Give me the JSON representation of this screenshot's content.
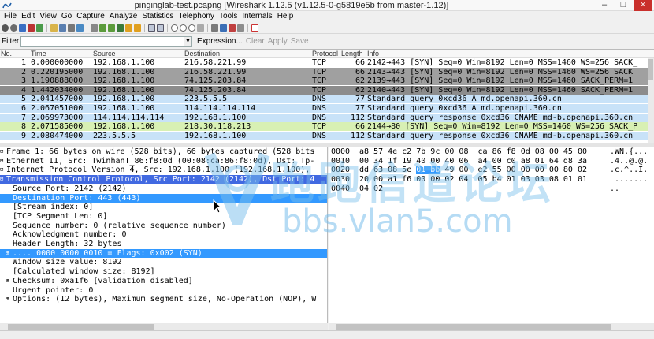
{
  "window": {
    "title": "pinginglab-test.pcapng   [Wireshark 1.12.5  (v1.12.5-0-g5819e5b from master-1.12)]",
    "min": "–",
    "max": "□",
    "close": "×"
  },
  "menu": [
    "File",
    "Edit",
    "View",
    "Go",
    "Capture",
    "Analyze",
    "Statistics",
    "Telephony",
    "Tools",
    "Internals",
    "Help"
  ],
  "filter": {
    "label": "Filter:",
    "value": "",
    "expression": "Expression...",
    "clear": "Clear",
    "apply": "Apply",
    "save": "Save"
  },
  "packet_list": {
    "columns": {
      "no": "No.",
      "time": "Time",
      "source": "Source",
      "destination": "Destination",
      "protocol": "Protocol",
      "length": "Length",
      "info": "Info"
    },
    "rows": [
      {
        "no": "1",
        "time": "0.000000000",
        "src": "192.168.1.100",
        "dst": "216.58.221.99",
        "proto": "TCP",
        "len": "66",
        "info": "2142→443 [SYN] Seq=0 Win=8192 Len=0 MSS=1460 WS=256 SACK_",
        "bg": "#ffffff",
        "fg": "#000000"
      },
      {
        "no": "2",
        "time": "0.220195000",
        "src": "192.168.1.100",
        "dst": "216.58.221.99",
        "proto": "TCP",
        "len": "66",
        "info": "2143→443 [SYN] Seq=0 Win=8192 Len=0 MSS=1460 WS=256 SACK_",
        "bg": "#a0a0a0",
        "fg": "#000000"
      },
      {
        "no": "3",
        "time": "1.190888000",
        "src": "192.168.1.100",
        "dst": "74.125.203.84",
        "proto": "TCP",
        "len": "62",
        "info": "2139→443 [SYN] Seq=0 Win=8192 Len=0 MSS=1460 SACK_PERM=1",
        "bg": "#a0a0a0",
        "fg": "#000000"
      },
      {
        "no": "4",
        "time": "1.442034000",
        "src": "192.168.1.100",
        "dst": "74.125.203.84",
        "proto": "TCP",
        "len": "62",
        "info": "2140→443 [SYN] Seq=0 Win=8192 Len=0 MSS=1460 SACK_PERM=1",
        "bg": "#8c8c8c",
        "fg": "#000000"
      },
      {
        "no": "5",
        "time": "2.041457000",
        "src": "192.168.1.100",
        "dst": "223.5.5.5",
        "proto": "DNS",
        "len": "77",
        "info": "Standard query 0xcd36  A md.openapi.360.cn",
        "bg": "#c8e2f8",
        "fg": "#000000"
      },
      {
        "no": "6",
        "time": "2.067051000",
        "src": "192.168.1.100",
        "dst": "114.114.114.114",
        "proto": "DNS",
        "len": "77",
        "info": "Standard query 0xcd36  A md.openapi.360.cn",
        "bg": "#c8e2f8",
        "fg": "#000000"
      },
      {
        "no": "7",
        "time": "2.069973000",
        "src": "114.114.114.114",
        "dst": "192.168.1.100",
        "proto": "DNS",
        "len": "112",
        "info": "Standard query response 0xcd36  CNAME md-b.openapi.360.cn",
        "bg": "#c8e2f8",
        "fg": "#000000"
      },
      {
        "no": "8",
        "time": "2.071585000",
        "src": "192.168.1.100",
        "dst": "218.30.118.213",
        "proto": "TCP",
        "len": "66",
        "info": "2144→80 [SYN] Seq=0 Win=8192 Len=0 MSS=1460 WS=256 SACK_P",
        "bg": "#d8f0b4",
        "fg": "#000000"
      },
      {
        "no": "9",
        "time": "2.080474000",
        "src": "223.5.5.5",
        "dst": "192.168.1.100",
        "proto": "DNS",
        "len": "112",
        "info": "Standard query response 0xcd36  CNAME md-b.openapi.360.cn",
        "bg": "#c8e2f8",
        "fg": "#000000"
      }
    ]
  },
  "details": [
    {
      "text": "Frame 1: 66 bytes on wire (528 bits), 66 bytes captured (528 bits",
      "indent": 0,
      "tw": "⊞",
      "style": ""
    },
    {
      "text": "Ethernet II, Src: TwinhanT_86:f8:0d (00:08:ca:86:f8:0d), Dst: Tp-",
      "indent": 0,
      "tw": "⊞",
      "style": ""
    },
    {
      "text": "Internet Protocol Version 4, Src: 192.168.1.100 (192.168.1.100),",
      "indent": 0,
      "tw": "⊞",
      "style": ""
    },
    {
      "text": "Transmission Control Protocol, Src Port: 2142 (2142), Dst Port: 4",
      "indent": 0,
      "tw": "⊟",
      "style": "proto-hl"
    },
    {
      "text": "Source Port: 2142 (2142)",
      "indent": 1,
      "tw": "",
      "style": ""
    },
    {
      "text": "Destination Port: 443 (443)",
      "indent": 1,
      "tw": "",
      "style": "sel"
    },
    {
      "text": "[Stream index: 0]",
      "indent": 1,
      "tw": "",
      "style": ""
    },
    {
      "text": "[TCP Segment Len: 0]",
      "indent": 1,
      "tw": "",
      "style": ""
    },
    {
      "text": "Sequence number: 0     (relative sequence number)",
      "indent": 1,
      "tw": "",
      "style": ""
    },
    {
      "text": "Acknowledgment number: 0",
      "indent": 1,
      "tw": "",
      "style": ""
    },
    {
      "text": "Header Length: 32 bytes",
      "indent": 1,
      "tw": "",
      "style": ""
    },
    {
      "text": ".... 0000 0000 0010 = Flags: 0x002 (SYN)",
      "indent": 1,
      "tw": "⊞",
      "style": "sel"
    },
    {
      "text": "Window size value: 8192",
      "indent": 1,
      "tw": "",
      "style": ""
    },
    {
      "text": "[Calculated window size: 8192]",
      "indent": 1,
      "tw": "",
      "style": ""
    },
    {
      "text": "Checksum: 0xa1f6 [validation disabled]",
      "indent": 1,
      "tw": "⊞",
      "style": ""
    },
    {
      "text": "Urgent pointer: 0",
      "indent": 1,
      "tw": "",
      "style": ""
    },
    {
      "text": "Options: (12 bytes), Maximum segment size, No-Operation (NOP), W",
      "indent": 1,
      "tw": "⊞",
      "style": ""
    }
  ],
  "bytes": [
    {
      "off": "0000",
      "pre": "a8 57 4e c2 7b 9c 00 08  ca 86 f8 0d 08 00 45 00",
      "hl": "",
      "post": "",
      "asc": ".WN.{..."
    },
    {
      "off": "0010",
      "pre": "00 34 1f 19 40 00 40 06  a4 00 c0 a8 01 64 d8 3a",
      "hl": "",
      "post": "",
      "asc": ".4..@.@."
    },
    {
      "off": "0020",
      "pre": "dd 63 08 5e ",
      "hl": "01 bb",
      "post": " 49 00  e2 55 00 00 00 00 80 02",
      "asc": ".c.^..I."
    },
    {
      "off": "0030",
      "pre": "20 00 a1 f6 00 00 02 04  05 b4 01 03 03 08 01 01",
      "hl": "",
      "post": "",
      "asc": " ......."
    },
    {
      "off": "0040",
      "pre": "04 02",
      "hl": "",
      "post": "",
      "asc": ".."
    }
  ],
  "watermark": {
    "cn": "跑跑信道论坛",
    "url": "bbs.vlan5.com"
  },
  "colors": {
    "selection": "#3399ff",
    "dns_row": "#c8e2f8",
    "tcp_http_row": "#d8f0b4",
    "syn_row": "#a0a0a0"
  }
}
